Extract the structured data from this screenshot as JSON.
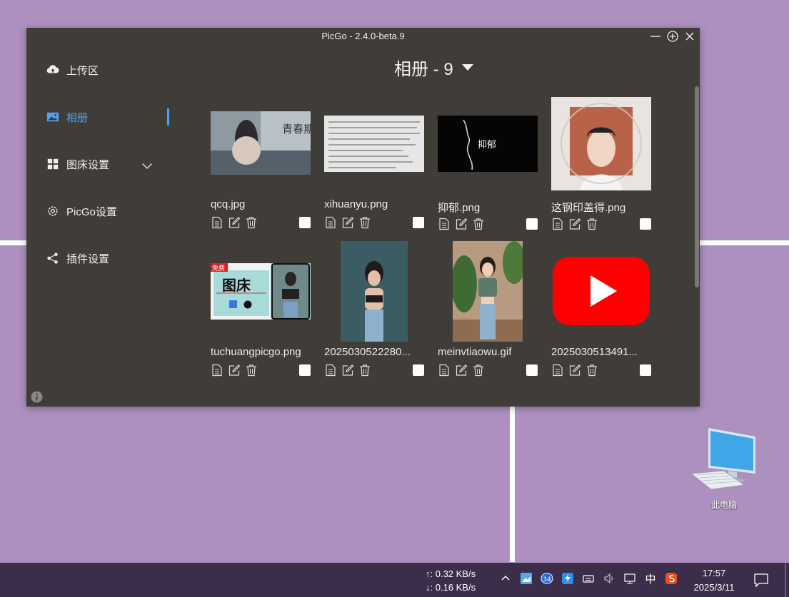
{
  "window": {
    "title": "PicGo - 2.4.0-beta.9"
  },
  "sidebar": {
    "items": [
      {
        "label": "上传区",
        "icon": "cloud-upload-icon"
      },
      {
        "label": "相册",
        "icon": "image-icon",
        "active": true
      },
      {
        "label": "图床设置",
        "icon": "grid-icon",
        "expandable": true
      },
      {
        "label": "PicGo设置",
        "icon": "gear-icon"
      },
      {
        "label": "插件设置",
        "icon": "share-icon"
      }
    ]
  },
  "gallery": {
    "title": "相册 - 9",
    "images": [
      {
        "name": "qcq.jpg",
        "overlay": "青春期"
      },
      {
        "name": "xihuanyu.png",
        "overlay": ""
      },
      {
        "name": "抑郁.png",
        "overlay": "抑郁"
      },
      {
        "name": "这钢印盖得.png",
        "overlay": ""
      },
      {
        "name": "tuchuangpicgo.png",
        "overlay": "图床",
        "badge": "免费"
      },
      {
        "name": "2025030522280...",
        "overlay": ""
      },
      {
        "name": "meinvtiaowu.gif",
        "overlay": ""
      },
      {
        "name": "2025030513491...",
        "overlay": ""
      }
    ]
  },
  "desktop": {
    "pc_label": "此电脑"
  },
  "taskbar": {
    "upload_speed": "↑: 0.32 KB/s",
    "download_speed": "↓: 0.16 KB/s",
    "ime": "中",
    "badge": "34",
    "time": "17:57",
    "date": "2025/3/11"
  },
  "colors": {
    "window_bg": "#403c38",
    "accent": "#4fa3ef",
    "desktop_bg": "#ad90c0",
    "taskbar_bg": "#3c2e4a"
  }
}
